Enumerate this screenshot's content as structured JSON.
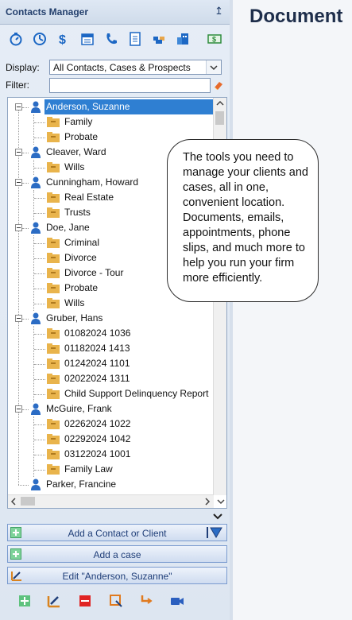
{
  "panel": {
    "title": "Contacts Manager",
    "pin_label": "↥"
  },
  "toolbar": {
    "icons": [
      "timer-icon",
      "clock-icon",
      "billing-icon",
      "calendar-icon",
      "phone-icon",
      "document-icon",
      "handshake-icon",
      "building-icon",
      "money-icon"
    ]
  },
  "filters": {
    "display_label": "Display:",
    "display_value": "All Contacts, Cases & Prospects",
    "filter_label": "Filter:",
    "filter_value": ""
  },
  "tree": {
    "contacts": [
      {
        "name": "Anderson, Suzanne",
        "selected": true,
        "cases": [
          "Family",
          "Probate"
        ]
      },
      {
        "name": "Cleaver, Ward",
        "cases": [
          "Wills"
        ]
      },
      {
        "name": "Cunningham, Howard",
        "cases": [
          "Real Estate",
          "Trusts"
        ]
      },
      {
        "name": "Doe, Jane",
        "cases": [
          "Criminal",
          "Divorce",
          "Divorce - Tour",
          "Probate",
          "Wills"
        ]
      },
      {
        "name": "Gruber, Hans",
        "cases": [
          "01082024 1036",
          "01182024 1413",
          "01242024 1101",
          "02022024 1311",
          "Child Support Delinquency Report"
        ]
      },
      {
        "name": "McGuire, Frank",
        "cases": [
          "02262024 1022",
          "02292024 1042",
          "03122024 1001",
          "Family Law"
        ]
      },
      {
        "name": "Parker, Francine",
        "cases": []
      }
    ]
  },
  "actions": {
    "add_contact": "Add a Contact or Client",
    "add_case": "Add a case",
    "edit": "Edit \"Anderson, Suzanne\""
  },
  "bottom_toolbar": [
    "add-icon",
    "edit-icon",
    "delete-icon",
    "export-icon",
    "return-icon",
    "video-icon"
  ],
  "main": {
    "title": "Document"
  },
  "callout": {
    "text": "The tools you need to manage your clients and cases, all in one, convenient location. Documents, emails, appointments, phone slips, and much more to help you run your firm more efficiently."
  },
  "colors": {
    "accent": "#2f7fd2",
    "panel_title": "#24406d",
    "button_text": "#1f3e78",
    "case_folder": "#e9b44c"
  }
}
